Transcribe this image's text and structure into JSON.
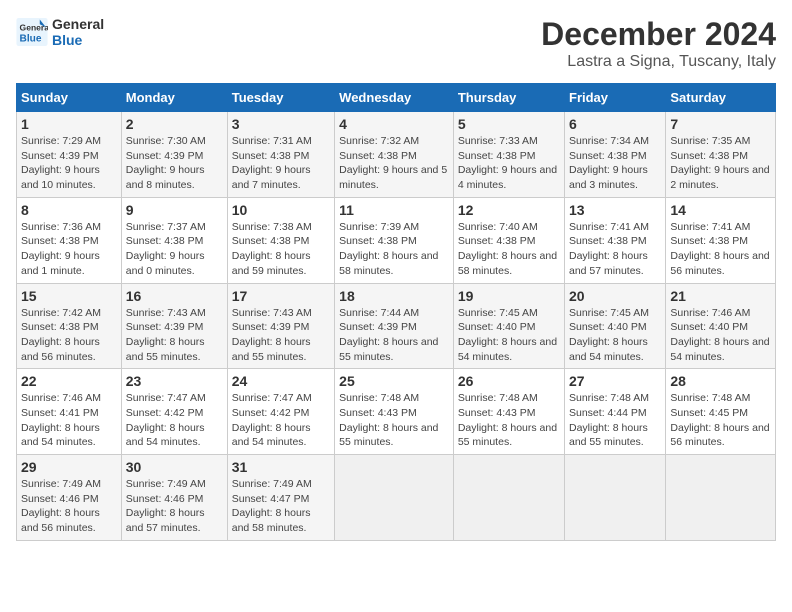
{
  "logo": {
    "text_general": "General",
    "text_blue": "Blue"
  },
  "title": "December 2024",
  "subtitle": "Lastra a Signa, Tuscany, Italy",
  "header_color": "#1a6bb5",
  "days_of_week": [
    "Sunday",
    "Monday",
    "Tuesday",
    "Wednesday",
    "Thursday",
    "Friday",
    "Saturday"
  ],
  "weeks": [
    [
      {
        "day": "1",
        "sunrise": "7:29 AM",
        "sunset": "4:39 PM",
        "daylight": "9 hours and 10 minutes."
      },
      {
        "day": "2",
        "sunrise": "7:30 AM",
        "sunset": "4:39 PM",
        "daylight": "9 hours and 8 minutes."
      },
      {
        "day": "3",
        "sunrise": "7:31 AM",
        "sunset": "4:38 PM",
        "daylight": "9 hours and 7 minutes."
      },
      {
        "day": "4",
        "sunrise": "7:32 AM",
        "sunset": "4:38 PM",
        "daylight": "9 hours and 5 minutes."
      },
      {
        "day": "5",
        "sunrise": "7:33 AM",
        "sunset": "4:38 PM",
        "daylight": "9 hours and 4 minutes."
      },
      {
        "day": "6",
        "sunrise": "7:34 AM",
        "sunset": "4:38 PM",
        "daylight": "9 hours and 3 minutes."
      },
      {
        "day": "7",
        "sunrise": "7:35 AM",
        "sunset": "4:38 PM",
        "daylight": "9 hours and 2 minutes."
      }
    ],
    [
      {
        "day": "8",
        "sunrise": "7:36 AM",
        "sunset": "4:38 PM",
        "daylight": "9 hours and 1 minute."
      },
      {
        "day": "9",
        "sunrise": "7:37 AM",
        "sunset": "4:38 PM",
        "daylight": "9 hours and 0 minutes."
      },
      {
        "day": "10",
        "sunrise": "7:38 AM",
        "sunset": "4:38 PM",
        "daylight": "8 hours and 59 minutes."
      },
      {
        "day": "11",
        "sunrise": "7:39 AM",
        "sunset": "4:38 PM",
        "daylight": "8 hours and 58 minutes."
      },
      {
        "day": "12",
        "sunrise": "7:40 AM",
        "sunset": "4:38 PM",
        "daylight": "8 hours and 58 minutes."
      },
      {
        "day": "13",
        "sunrise": "7:41 AM",
        "sunset": "4:38 PM",
        "daylight": "8 hours and 57 minutes."
      },
      {
        "day": "14",
        "sunrise": "7:41 AM",
        "sunset": "4:38 PM",
        "daylight": "8 hours and 56 minutes."
      }
    ],
    [
      {
        "day": "15",
        "sunrise": "7:42 AM",
        "sunset": "4:38 PM",
        "daylight": "8 hours and 56 minutes."
      },
      {
        "day": "16",
        "sunrise": "7:43 AM",
        "sunset": "4:39 PM",
        "daylight": "8 hours and 55 minutes."
      },
      {
        "day": "17",
        "sunrise": "7:43 AM",
        "sunset": "4:39 PM",
        "daylight": "8 hours and 55 minutes."
      },
      {
        "day": "18",
        "sunrise": "7:44 AM",
        "sunset": "4:39 PM",
        "daylight": "8 hours and 55 minutes."
      },
      {
        "day": "19",
        "sunrise": "7:45 AM",
        "sunset": "4:40 PM",
        "daylight": "8 hours and 54 minutes."
      },
      {
        "day": "20",
        "sunrise": "7:45 AM",
        "sunset": "4:40 PM",
        "daylight": "8 hours and 54 minutes."
      },
      {
        "day": "21",
        "sunrise": "7:46 AM",
        "sunset": "4:40 PM",
        "daylight": "8 hours and 54 minutes."
      }
    ],
    [
      {
        "day": "22",
        "sunrise": "7:46 AM",
        "sunset": "4:41 PM",
        "daylight": "8 hours and 54 minutes."
      },
      {
        "day": "23",
        "sunrise": "7:47 AM",
        "sunset": "4:42 PM",
        "daylight": "8 hours and 54 minutes."
      },
      {
        "day": "24",
        "sunrise": "7:47 AM",
        "sunset": "4:42 PM",
        "daylight": "8 hours and 54 minutes."
      },
      {
        "day": "25",
        "sunrise": "7:48 AM",
        "sunset": "4:43 PM",
        "daylight": "8 hours and 55 minutes."
      },
      {
        "day": "26",
        "sunrise": "7:48 AM",
        "sunset": "4:43 PM",
        "daylight": "8 hours and 55 minutes."
      },
      {
        "day": "27",
        "sunrise": "7:48 AM",
        "sunset": "4:44 PM",
        "daylight": "8 hours and 55 minutes."
      },
      {
        "day": "28",
        "sunrise": "7:48 AM",
        "sunset": "4:45 PM",
        "daylight": "8 hours and 56 minutes."
      }
    ],
    [
      {
        "day": "29",
        "sunrise": "7:49 AM",
        "sunset": "4:46 PM",
        "daylight": "8 hours and 56 minutes."
      },
      {
        "day": "30",
        "sunrise": "7:49 AM",
        "sunset": "4:46 PM",
        "daylight": "8 hours and 57 minutes."
      },
      {
        "day": "31",
        "sunrise": "7:49 AM",
        "sunset": "4:47 PM",
        "daylight": "8 hours and 58 minutes."
      },
      null,
      null,
      null,
      null
    ]
  ]
}
